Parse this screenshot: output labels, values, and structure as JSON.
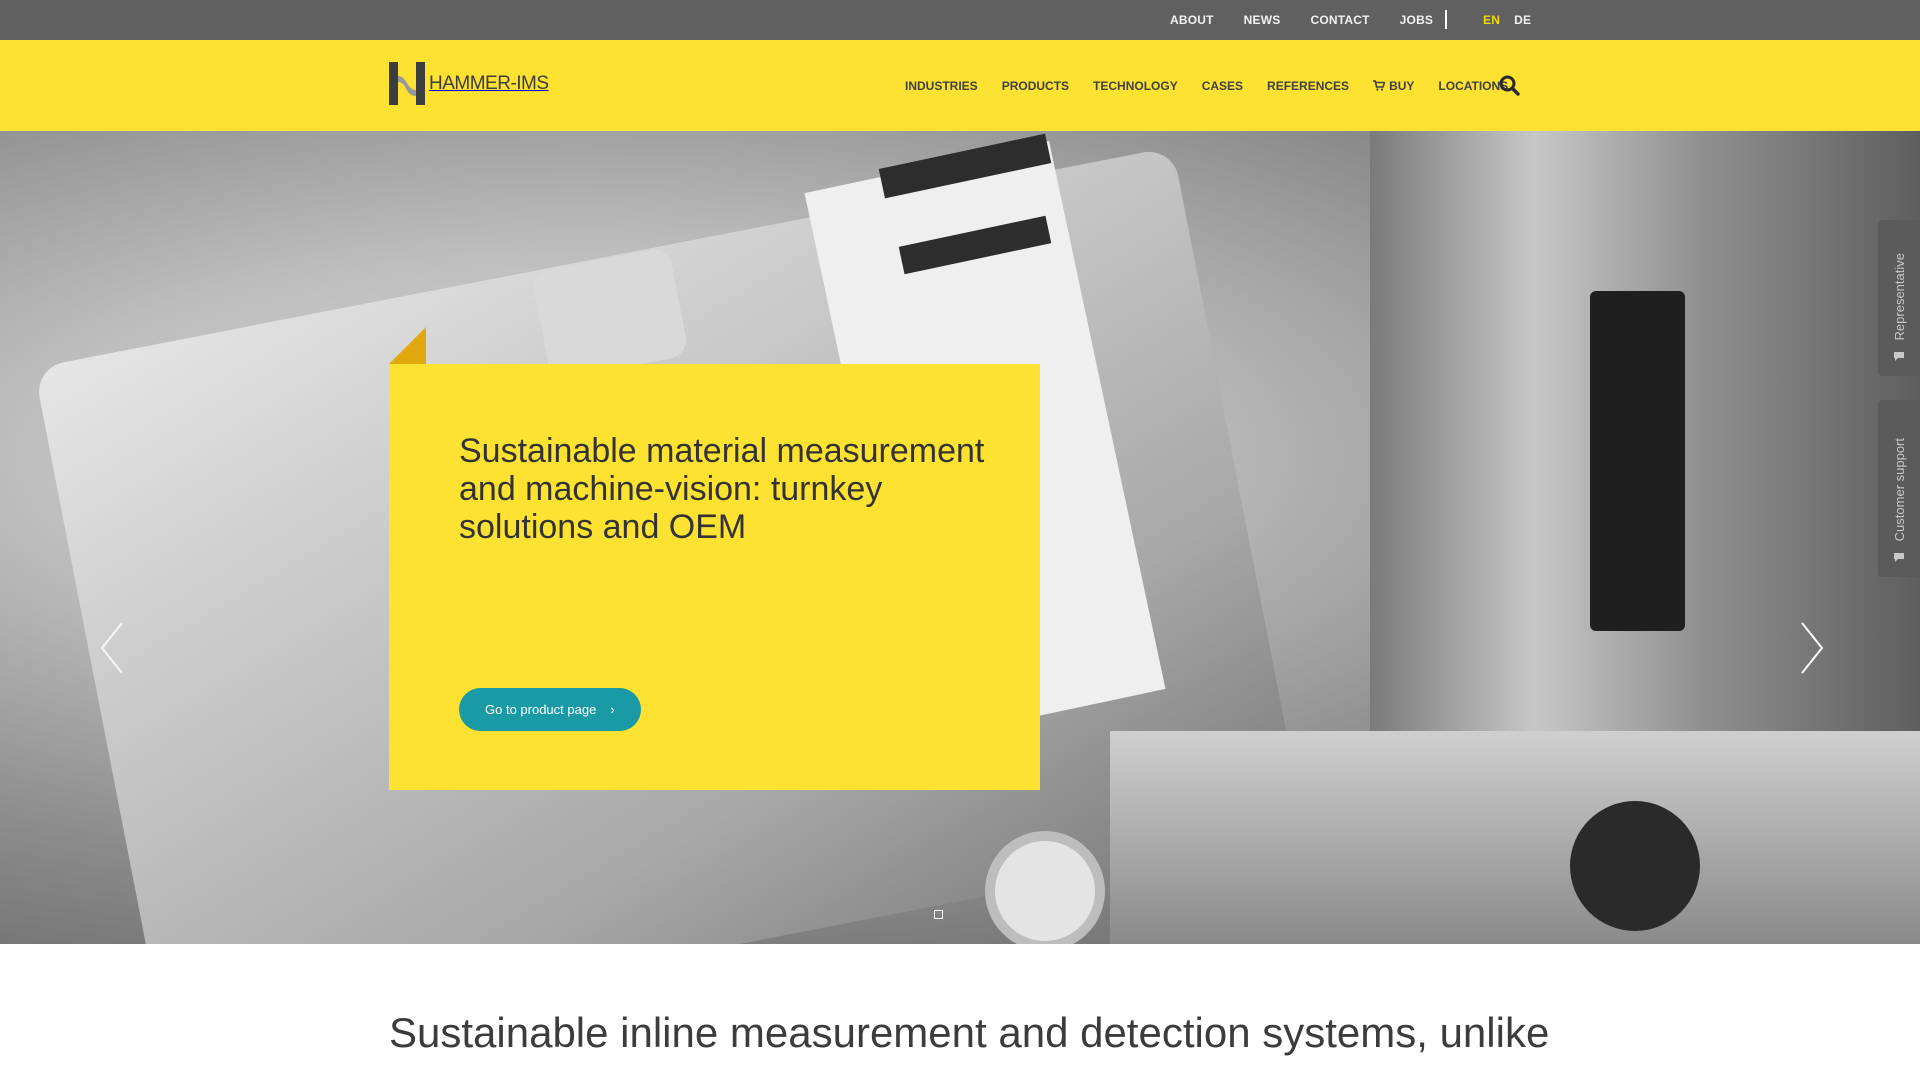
{
  "topbar": {
    "links": [
      "ABOUT",
      "NEWS",
      "CONTACT",
      "JOBS"
    ],
    "separator": "|",
    "languages": [
      "EN",
      "DE"
    ],
    "active_language": "EN",
    "background": "#606060",
    "active_color": "#f4d900"
  },
  "header": {
    "logo_text": "HAMMER-IMS",
    "nav": [
      "INDUSTRIES",
      "PRODUCTS",
      "TECHNOLOGY",
      "CASES",
      "REFERENCES",
      "BUY",
      "LOCATIONS"
    ],
    "search_icon": "search-icon",
    "cart_icon": "cart-icon",
    "background": "#fde231"
  },
  "hero": {
    "title": "Sustainable material measurement and machine-vision: turnkey solutions and OEM",
    "cta_label": "Go to product page",
    "cta_icon": "chevron-right-icon",
    "cta_color": "#1a9aa4",
    "card_color": "#fde231",
    "fold_color": "#e2a90f",
    "prev_icon": "chevron-left-icon",
    "next_icon": "chevron-right-icon"
  },
  "side_tabs": [
    {
      "label": "Representative",
      "icon": "chat-icon"
    },
    {
      "label": "Customer support",
      "icon": "chat-icon"
    }
  ],
  "intro": {
    "text": "Sustainable inline measurement and detection systems, unlike"
  }
}
